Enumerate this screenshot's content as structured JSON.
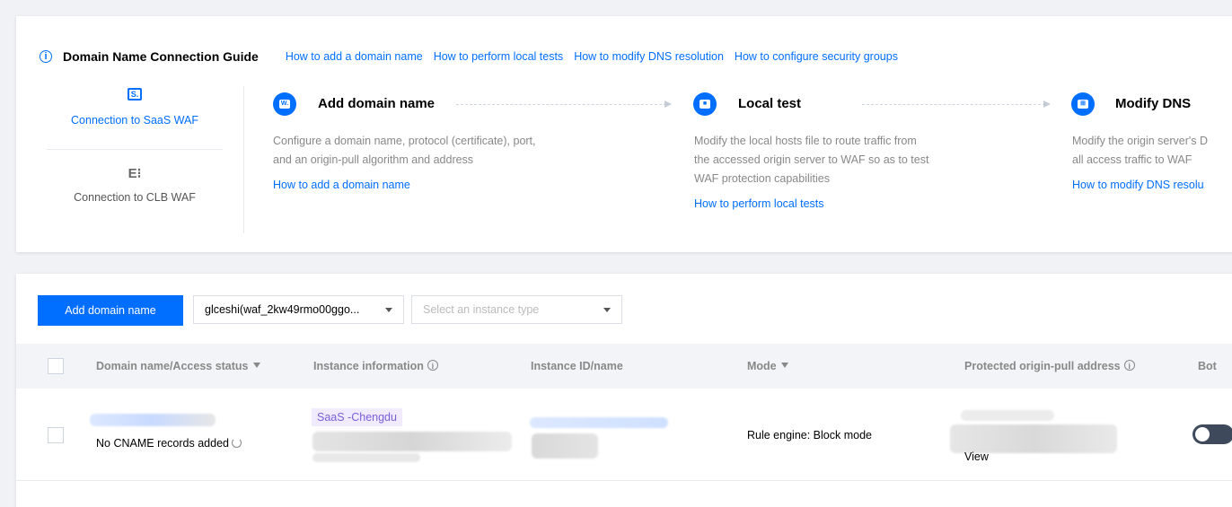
{
  "guide": {
    "title": "Domain Name Connection Guide",
    "links": [
      "How to add a domain name",
      "How to perform local tests",
      "How to modify DNS resolution",
      "How to configure security groups"
    ],
    "connection_types": [
      {
        "label": "Connection to SaaS WAF",
        "icon": "saas-icon",
        "glyph": "S."
      },
      {
        "label": "Connection to CLB WAF",
        "icon": "clb-icon",
        "glyph": "E⁝"
      }
    ],
    "steps": [
      {
        "title": "Add domain name",
        "desc": [
          "Configure a domain name, protocol (certificate), port,",
          "and an origin-pull algorithm and address"
        ],
        "link": "How to add a domain name"
      },
      {
        "title": "Local test",
        "desc": [
          "Modify the local hosts file to route traffic from",
          "the accessed origin server to WAF so as to test",
          "WAF protection capabilities"
        ],
        "link": "How to perform local tests"
      },
      {
        "title": "Modify DNS",
        "desc": [
          "Modify the origin server's D",
          "all access traffic to WAF"
        ],
        "link": "How to modify DNS resolu"
      }
    ]
  },
  "toolbar": {
    "add_button": "Add domain name",
    "instance_select": "glceshi(waf_2kw49rmo00ggo...",
    "type_select_placeholder": "Select an instance type"
  },
  "table": {
    "headers": {
      "domain": "Domain name/Access status",
      "instance_info": "Instance information",
      "instance_id": "Instance ID/name",
      "mode": "Mode",
      "origin": "Protected origin-pull address",
      "bot": "Bot"
    },
    "rows": [
      {
        "status": "No CNAME records added",
        "instance_tag": "SaaS -Chengdu",
        "mode": "Rule engine: Block mode",
        "view_link": "View"
      }
    ]
  },
  "colors": {
    "primary": "#006eff",
    "tag_bg": "#f0ebff",
    "tag_text": "#7b5fd6",
    "toggle": "#3e4a5c"
  }
}
